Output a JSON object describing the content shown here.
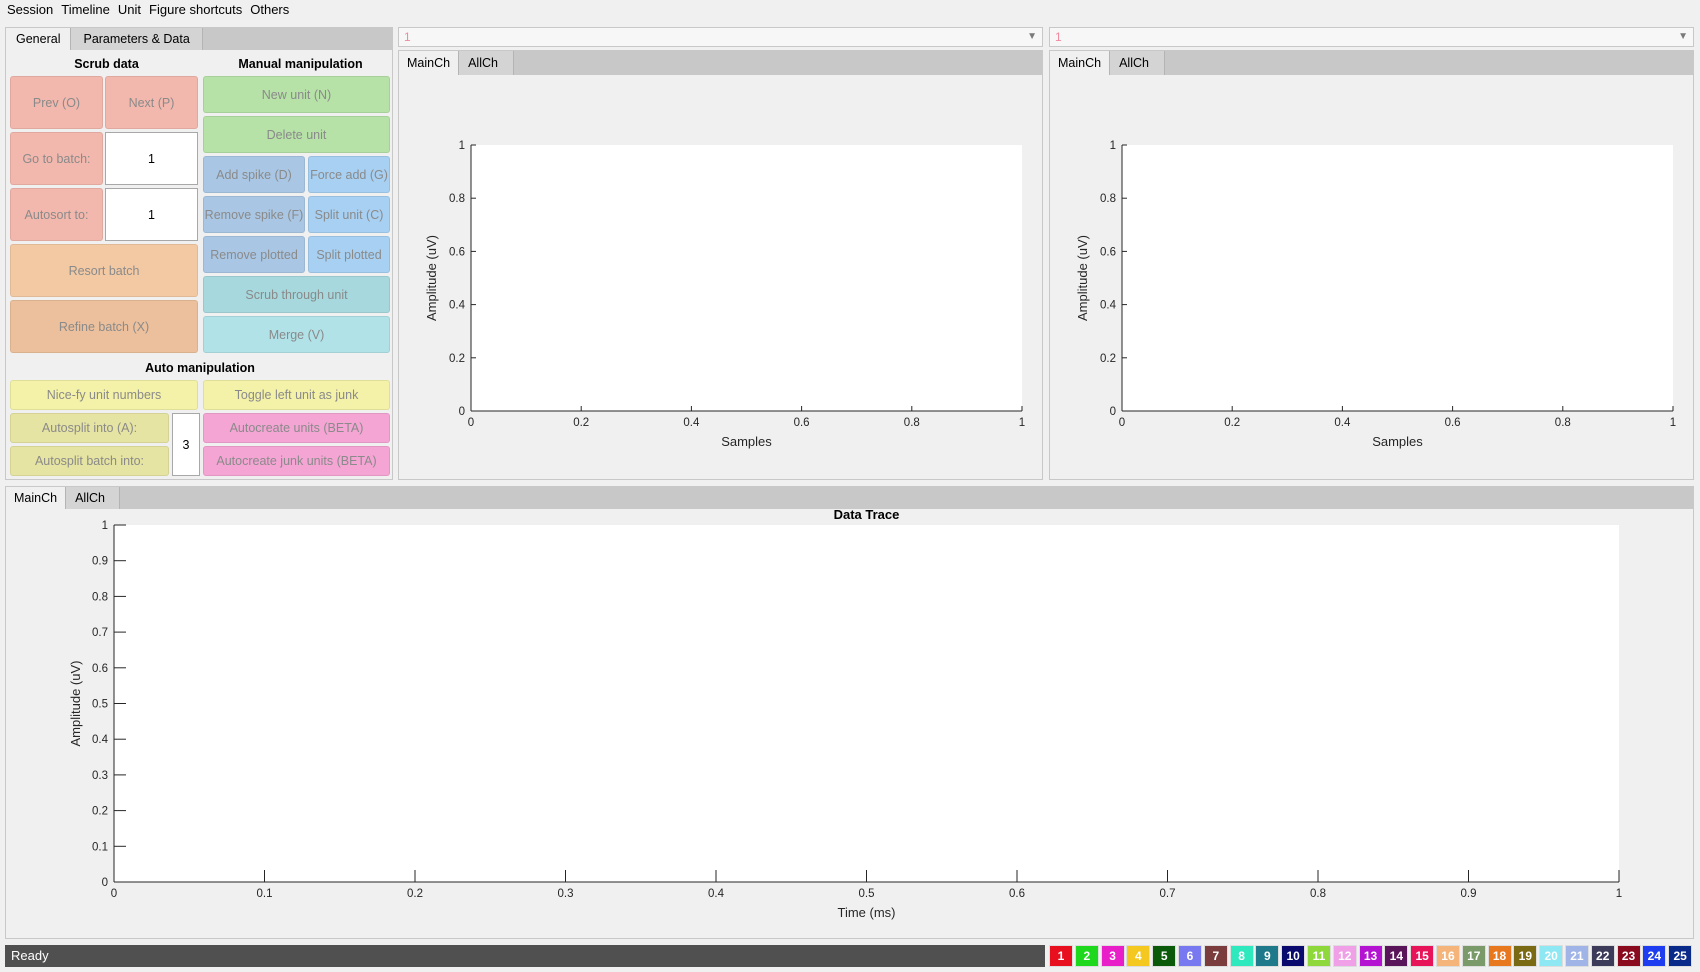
{
  "menu": [
    "Session",
    "Timeline",
    "Unit",
    "Figure shortcuts",
    "Others"
  ],
  "left_panel": {
    "tabs": [
      "General",
      "Parameters & Data"
    ],
    "active_tab": "General",
    "scrub": {
      "title": "Scrub data",
      "prev": "Prev (O)",
      "next": "Next (P)",
      "go_to_batch": "Go to batch:",
      "go_to_batch_value": "1",
      "autosort_to": "Autosort to:",
      "autosort_value": "1",
      "resort": "Resort batch",
      "refine": "Refine batch (X)"
    },
    "manual": {
      "title": "Manual manipulation",
      "new_unit": "New unit (N)",
      "delete_unit": "Delete unit",
      "add_spike": "Add spike (D)",
      "force_add": "Force add (G)",
      "remove_spike": "Remove spike (F)",
      "split_unit": "Split unit (C)",
      "remove_plotted": "Remove plotted",
      "split_plotted": "Split plotted",
      "scrub_unit": "Scrub through unit",
      "merge": "Merge (V)"
    },
    "auto": {
      "title": "Auto manipulation",
      "nicefy": "Nice-fy unit numbers",
      "toggle_junk": "Toggle left unit as junk",
      "autosplit": "Autosplit into (A):",
      "autosplit_batch": "Autosplit batch into:",
      "autosplit_value": "3",
      "autocreate": "Autocreate units (BETA)",
      "autocreate_junk": "Autocreate junk units (BETA)"
    }
  },
  "unit_panels": [
    {
      "selected": "1",
      "tabs": [
        "MainCh",
        "AllCh"
      ],
      "active_tab": "MainCh"
    },
    {
      "selected": "1",
      "tabs": [
        "MainCh",
        "AllCh"
      ],
      "active_tab": "MainCh"
    }
  ],
  "trace_panel": {
    "tabs": [
      "MainCh",
      "AllCh"
    ],
    "active_tab": "MainCh"
  },
  "chart_data": [
    {
      "type": "line",
      "title": "",
      "xlabel": "Samples",
      "ylabel": "Amplitude (uV)",
      "xlim": [
        0,
        1
      ],
      "ylim": [
        0,
        1
      ],
      "xticks": [
        "0",
        "0.2",
        "0.4",
        "0.6",
        "0.8",
        "1"
      ],
      "yticks": [
        "0",
        "0.2",
        "0.4",
        "0.6",
        "0.8",
        "1"
      ],
      "series": []
    },
    {
      "type": "line",
      "title": "",
      "xlabel": "Samples",
      "ylabel": "Amplitude (uV)",
      "xlim": [
        0,
        1
      ],
      "ylim": [
        0,
        1
      ],
      "xticks": [
        "0",
        "0.2",
        "0.4",
        "0.6",
        "0.8",
        "1"
      ],
      "yticks": [
        "0",
        "0.2",
        "0.4",
        "0.6",
        "0.8",
        "1"
      ],
      "series": []
    },
    {
      "type": "line",
      "title": "Data Trace",
      "xlabel": "Time (ms)",
      "ylabel": "Amplitude (uV)",
      "xlim": [
        0,
        1
      ],
      "ylim": [
        0,
        1
      ],
      "xticks": [
        "0",
        "0.1",
        "0.2",
        "0.3",
        "0.4",
        "0.5",
        "0.6",
        "0.7",
        "0.8",
        "0.9",
        "1"
      ],
      "yticks": [
        "0",
        "0.1",
        "0.2",
        "0.3",
        "0.4",
        "0.5",
        "0.6",
        "0.7",
        "0.8",
        "0.9",
        "1"
      ],
      "series": []
    }
  ],
  "status": "Ready",
  "unit_colors": [
    {
      "label": "1",
      "color": "#e8101e"
    },
    {
      "label": "2",
      "color": "#1ed81e"
    },
    {
      "label": "3",
      "color": "#e81ec8"
    },
    {
      "label": "4",
      "color": "#f4c81e"
    },
    {
      "label": "5",
      "color": "#0a5a0a"
    },
    {
      "label": "6",
      "color": "#7878f0"
    },
    {
      "label": "7",
      "color": "#7a3c3c"
    },
    {
      "label": "8",
      "color": "#2ee8be"
    },
    {
      "label": "9",
      "color": "#1e7a8a"
    },
    {
      "label": "10",
      "color": "#0a0a6e"
    },
    {
      "label": "11",
      "color": "#8ed83c"
    },
    {
      "label": "12",
      "color": "#f0a0e6"
    },
    {
      "label": "13",
      "color": "#b414d2"
    },
    {
      "label": "14",
      "color": "#5a145a"
    },
    {
      "label": "15",
      "color": "#e8145a"
    },
    {
      "label": "16",
      "color": "#f4b47a"
    },
    {
      "label": "17",
      "color": "#7a9a6a"
    },
    {
      "label": "18",
      "color": "#e8781e"
    },
    {
      "label": "19",
      "color": "#7a6a14"
    },
    {
      "label": "20",
      "color": "#8ee8f4"
    },
    {
      "label": "21",
      "color": "#a0b4e8"
    },
    {
      "label": "22",
      "color": "#3c3c5a"
    },
    {
      "label": "23",
      "color": "#8a0a1e"
    },
    {
      "label": "24",
      "color": "#1e3cf0"
    },
    {
      "label": "25",
      "color": "#0a2a8a"
    }
  ]
}
